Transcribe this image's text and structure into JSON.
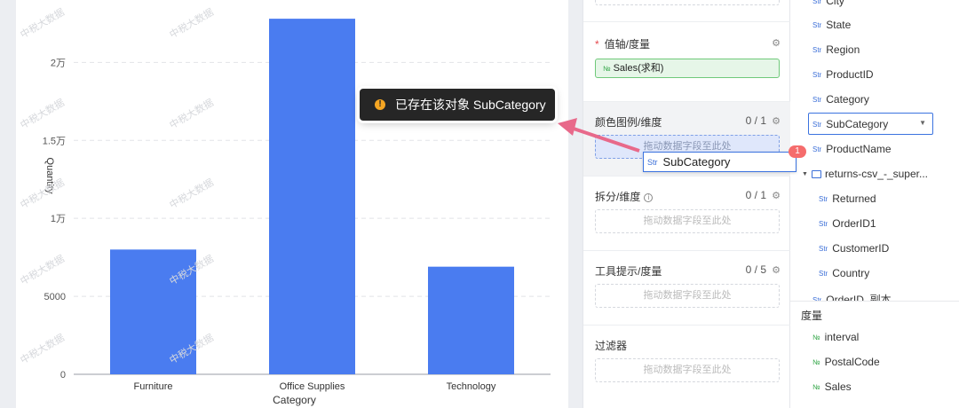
{
  "watermark": "中税大数据",
  "chart_data": {
    "type": "bar",
    "categories": [
      "Furniture",
      "Office Supplies",
      "Technology"
    ],
    "values": [
      8000,
      22800,
      6900
    ],
    "xlabel": "Category",
    "ylabel": "Quantity",
    "ylim": [
      0,
      24000
    ],
    "yticks": [
      {
        "value": 0,
        "label": "0"
      },
      {
        "value": 5000,
        "label": "5000"
      },
      {
        "value": 10000,
        "label": "1万"
      },
      {
        "value": 15000,
        "label": "1.5万"
      },
      {
        "value": 20000,
        "label": "2万"
      }
    ],
    "bar_color": "#4a7cf0",
    "grid": true
  },
  "config": {
    "value_axis": {
      "title": "值轴/度量",
      "required_mark": "*",
      "pill_type": "№",
      "pill_label": "Sales(求和)"
    },
    "color_legend": {
      "title": "颜色图例/维度",
      "count": "0 / 1",
      "drop_placeholder": "拖动数据字段至此处"
    },
    "split": {
      "title": "拆分/维度",
      "count": "0 / 1",
      "drop_placeholder": "拖动数据字段至此处"
    },
    "tooltip": {
      "title": "工具提示/度量",
      "count": "0 / 5",
      "drop_placeholder": "拖动数据字段至此处"
    },
    "filter": {
      "title": "过滤器",
      "drop_placeholder": "拖动数据字段至此处"
    }
  },
  "fields": {
    "dimensions": [
      {
        "type": "Str",
        "name": "City"
      },
      {
        "type": "Str",
        "name": "State"
      },
      {
        "type": "Str",
        "name": "Region"
      },
      {
        "type": "Str",
        "name": "ProductID"
      },
      {
        "type": "Str",
        "name": "Category"
      },
      {
        "type": "Str",
        "name": "SubCategory"
      },
      {
        "type": "Str",
        "name": "ProductName"
      }
    ],
    "folder": {
      "name": "returns-csv_-_super...",
      "arrow": "▼"
    },
    "folder_fields": [
      {
        "type": "Str",
        "name": "Returned"
      },
      {
        "type": "Str",
        "name": "OrderID1"
      },
      {
        "type": "Str",
        "name": "CustomerID"
      },
      {
        "type": "Str",
        "name": "Country"
      },
      {
        "type": "Str",
        "name": "OrderID_副本"
      }
    ],
    "measures_title": "度量",
    "measures": [
      {
        "type": "№",
        "name": "interval"
      },
      {
        "type": "№",
        "name": "PostalCode"
      },
      {
        "type": "№",
        "name": "Sales"
      }
    ]
  },
  "drag": {
    "type": "Str",
    "label": "SubCategory",
    "badge": "1"
  },
  "toast": {
    "icon": "!",
    "message": "已存在该对象 SubCategory"
  },
  "colors": {
    "accent": "#3b73e0",
    "bar": "#4a7cf0",
    "arrow": "#e8698a",
    "measure_green": "#35a74a"
  }
}
